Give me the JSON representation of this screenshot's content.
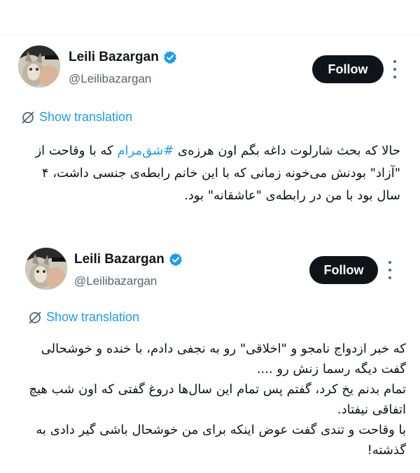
{
  "tweets": [
    {
      "author": {
        "name": "Leili Bazargan",
        "handle": "@Leilibazargan",
        "verified": true
      },
      "follow_label": "Follow",
      "translate_label": "Show translation",
      "text_before_hashtag": "حالا که بحث شارلوت داغه بگم اون هرزه‌ی ",
      "hashtag": "#شق‌مرام",
      "text_after_hashtag": " که با وقاحت از \"آزاد\" بودنش می‌خونه زمانی که با این خانم رابطه‌ی جنسی داشت، ۴ سال بود با من در رابطه‌ی \"عاشقانه\" بود."
    },
    {
      "author": {
        "name": "Leili Bazargan",
        "handle": "@Leilibazargan",
        "verified": true
      },
      "follow_label": "Follow",
      "translate_label": "Show translation",
      "paragraphs": [
        "که خبر ازدواج نامجو و \"اخلاقی\" رو به نجفی دادم، با خنده و خوشحالی گفت دیگه رسما زنش رو ....",
        "تمام بدنم یخ کرد، گفتم پس تمام این سال‌ها دروغ گفتی که اون شب هیچ اتفاقی نیفتاد.",
        "با وقاحت و تندی گفت عوض اینکه برای من خوشحال باشی گیر دادی به گذشته!"
      ]
    }
  ],
  "colors": {
    "link_blue": "#1d9bf0",
    "text_primary": "#0f1419",
    "text_secondary": "#536471",
    "follow_bg": "#0f1419"
  },
  "icons": [
    "verified-badge-icon",
    "translate-icon",
    "more-options-icon",
    "avatar"
  ]
}
